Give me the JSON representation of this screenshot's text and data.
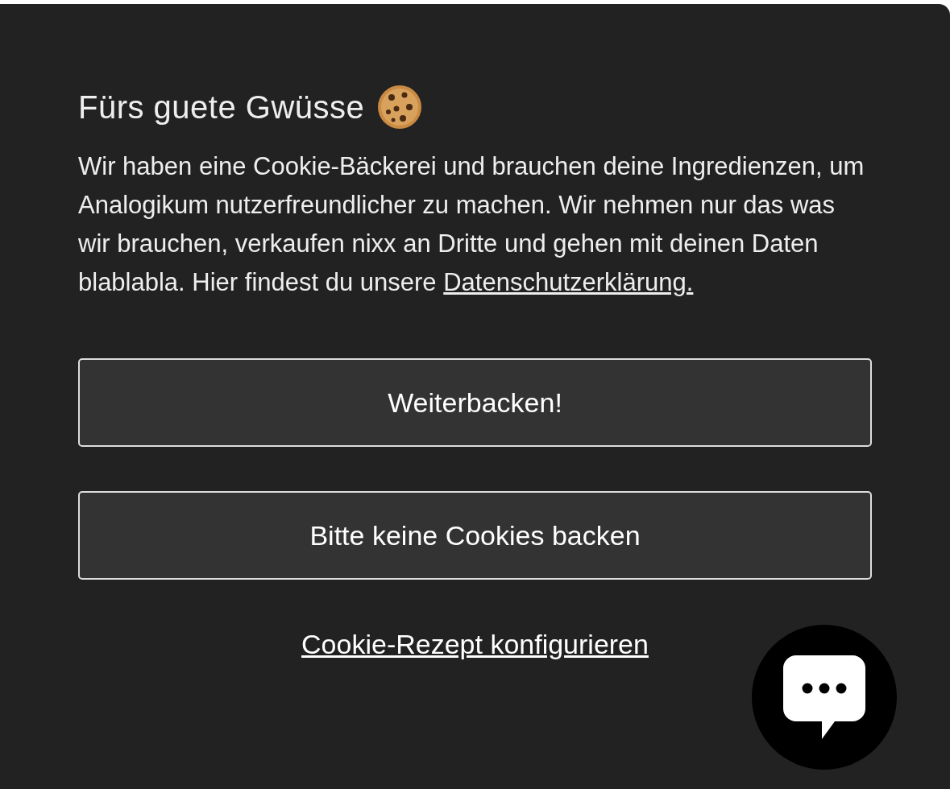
{
  "banner": {
    "title": "Fürs guete Gwüsse",
    "text": "Wir haben eine Cookie-Bäckerei und brauchen deine Ingredienzen, um Analogikum nutzerfreundlicher zu machen. Wir nehmen nur das was wir brauchen, verkaufen nixx an Dritte und gehen mit deinen Daten blablabla. Hier findest du unsere",
    "privacy_link": "Datenschutzerklärung.",
    "buttons": [
      {
        "label": "Weiterbacken!"
      },
      {
        "label": "Bitte keine Cookies backen"
      }
    ],
    "configure_link": "Cookie-Rezept konfigurieren"
  }
}
